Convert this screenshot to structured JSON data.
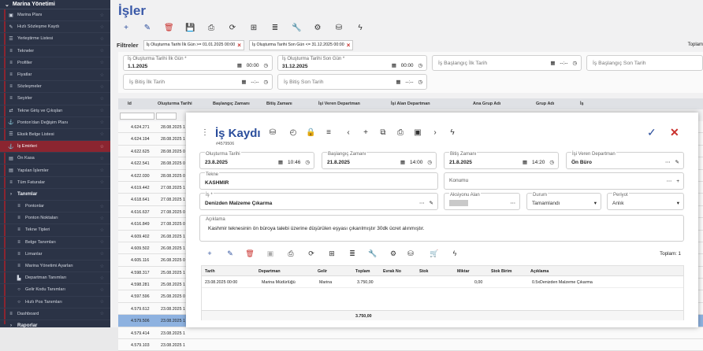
{
  "sidebar": {
    "title": "Marina Yönetimi",
    "items": [
      {
        "label": "Marina Planı",
        "icon": "▣",
        "type": "item"
      },
      {
        "label": "Hızlı Sözleşme Kaydı",
        "icon": "✎",
        "type": "item"
      },
      {
        "label": "Yerleştirme Listesi",
        "icon": "☰",
        "type": "item"
      },
      {
        "label": "Tekneler",
        "icon": "≡",
        "type": "item"
      },
      {
        "label": "Profiller",
        "icon": "≡",
        "type": "item"
      },
      {
        "label": "Fiyatlar",
        "icon": "≡",
        "type": "item"
      },
      {
        "label": "Sözleşmeler",
        "icon": "≡",
        "type": "item"
      },
      {
        "label": "Seyirler",
        "icon": "≡",
        "type": "item"
      },
      {
        "label": "Tekne Giriş ve Çıkışları",
        "icon": "⇄",
        "type": "item"
      },
      {
        "label": "Ponton'dan Değişim Planı",
        "icon": "⚓",
        "type": "item"
      },
      {
        "label": "Eksik Belge Listesi",
        "icon": "☰",
        "type": "item"
      },
      {
        "label": "İş Emirleri",
        "icon": "⚓",
        "type": "active"
      },
      {
        "label": "Ön Kasa",
        "icon": "▤",
        "type": "item"
      },
      {
        "label": "Yapılan İşlemler",
        "icon": "▤",
        "type": "item"
      },
      {
        "label": "Tüm Faturalar",
        "icon": "≡",
        "type": "item"
      },
      {
        "label": "Tanımlar",
        "icon": "›",
        "type": "group"
      },
      {
        "label": "Pontonlar",
        "icon": "≡",
        "type": "sub"
      },
      {
        "label": "Ponton Noktaları",
        "icon": "≡",
        "type": "sub"
      },
      {
        "label": "Tekne Tipleri",
        "icon": "≡",
        "type": "sub"
      },
      {
        "label": "Belge Tanımları",
        "icon": "≡",
        "type": "sub"
      },
      {
        "label": "Limanlar",
        "icon": "≡",
        "type": "sub"
      },
      {
        "label": "Marina Yönetimi Ayarları",
        "icon": "≡",
        "type": "sub"
      },
      {
        "label": "Departman Tanımları",
        "icon": "▙",
        "type": "sub"
      },
      {
        "label": "Gelir Kodu Tanımları",
        "icon": "○",
        "type": "sub"
      },
      {
        "label": "Hızlı Pos Tanımları",
        "icon": "○",
        "type": "sub"
      },
      {
        "label": "Dashboard",
        "icon": "≡",
        "type": "item"
      },
      {
        "label": "Raporlar",
        "icon": "›",
        "type": "group"
      }
    ]
  },
  "page": {
    "title": "İşler",
    "toolbar_icons": [
      "plus-icon",
      "edit-icon",
      "trash-icon",
      "save-icon",
      "print-icon",
      "refresh-icon",
      "excel-icon",
      "list-icon",
      "wrench-icon",
      "gear-icon",
      "database-icon",
      "bolt-icon"
    ],
    "toolbar_glyphs": [
      "+",
      "✎",
      "🗑",
      "💾",
      "⎙",
      "⟳",
      "⊞",
      "≣",
      "🔧",
      "⚙",
      "⛁",
      "ϟ"
    ]
  },
  "filters": {
    "label": "Filtreler",
    "chips": [
      "İş Oluşturma Tarihi İlk Gün >= 01.01.2025 00:00",
      "İş Oluşturma Tarihi Son Gün <= 31.12.2025 00:00"
    ],
    "toplam": "Toplam",
    "fields": {
      "created_first": {
        "label": "İş Oluşturma Tarihi İlk Gün *",
        "date": "1.1.2025",
        "time": "00:00"
      },
      "created_last": {
        "label": "İş Oluşturma Tarihi Son Gün *",
        "date": "31.12.2025",
        "time": "00:00"
      },
      "start_first": {
        "placeholder": "İş Başlangıç İlk Tarih",
        "time": "--:--"
      },
      "start_last": {
        "placeholder": "İş Başlangıç Son Tarih",
        "time": "--:--"
      },
      "end_first": {
        "placeholder": "İş Bitiş İlk Tarih",
        "time": "--:--"
      },
      "end_last": {
        "placeholder": "İş Bitiş Son Tarih",
        "time": "--:--"
      }
    }
  },
  "grid": {
    "columns": [
      "Id",
      "Oluşturma Tarihi",
      "Başlangıç Zamanı",
      "Bitiş Zamanı",
      "İşi Veren Departman",
      "İşi Alan Departman",
      "Ana Grup Adı",
      "Grup Adı",
      "İş"
    ],
    "rows": [
      {
        "id": "4.624.271",
        "date": "28.08.2025 1"
      },
      {
        "id": "4.624.194",
        "date": "28.08.2025 1"
      },
      {
        "id": "4.622.625",
        "date": "28.08.2025 0"
      },
      {
        "id": "4.622.541",
        "date": "28.08.2025 0"
      },
      {
        "id": "4.622.030",
        "date": "28.08.2025 0"
      },
      {
        "id": "4.619.442",
        "date": "27.08.2025 1"
      },
      {
        "id": "4.618.641",
        "date": "27.08.2025 1"
      },
      {
        "id": "4.616.637",
        "date": "27.08.2025 0"
      },
      {
        "id": "4.616.849",
        "date": "27.08.2025 0"
      },
      {
        "id": "4.609.402",
        "date": "26.08.2025 1"
      },
      {
        "id": "4.609.502",
        "date": "26.08.2025 1"
      },
      {
        "id": "4.605.116",
        "date": "26.08.2025 0"
      },
      {
        "id": "4.598.317",
        "date": "25.08.2025 1"
      },
      {
        "id": "4.598.281",
        "date": "25.08.2025 1"
      },
      {
        "id": "4.597.596",
        "date": "25.08.2025 0"
      },
      {
        "id": "4.579.612",
        "date": "23.08.2025 1"
      },
      {
        "id": "4.579.506",
        "date": "23.08.2025 1",
        "selected": true
      },
      {
        "id": "4.579.414",
        "date": "23.08.2025 1"
      },
      {
        "id": "4.579.103",
        "date": "23.08.2025 1"
      }
    ]
  },
  "modal": {
    "title": "İş Kaydı",
    "record_no": "#4579506",
    "fields": {
      "olusturma": {
        "label": "Oluşturma Tarihi",
        "date": "23.8.2025",
        "time": "10:46"
      },
      "baslangic": {
        "label": "Başlangıç Zamanı",
        "date": "21.8.2025",
        "time": "14:00"
      },
      "bitis": {
        "label": "Bitiş Zamanı",
        "date": "21.8.2025",
        "time": "14:20"
      },
      "veren": {
        "label": "İşi Veren Departman",
        "value": "Ön Büro"
      },
      "tekne": {
        "label": "Tekne",
        "value": "KASHMIR"
      },
      "konumu": {
        "placeholder": "Konumu"
      },
      "is": {
        "label": "İş *",
        "value": "Denizden Malzeme Çıkarma"
      },
      "aksiyonu": {
        "label": "Aksiyonu Alan"
      },
      "durum": {
        "label": "Durum",
        "value": "Tamamlandı"
      },
      "periyot": {
        "label": "Periyot",
        "value": "Anlık"
      },
      "aciklama": {
        "label": "Açıklama",
        "value": "Kashmir teknesinin ön büroya talebi üzerine düşürülen eşyası çıkarılmıştır 30dk ücret alınmıştır."
      }
    },
    "toplam": "Toplam: 1",
    "detail_columns": [
      "Tarih",
      "Departman",
      "Gelir",
      "Toplam",
      "Evrak No",
      "Stok",
      "Miktar",
      "Stok Birim",
      "Açıklama"
    ],
    "detail_rows": [
      {
        "tarih": "23.08.2025 00:00",
        "departman": "Marina Müdürlüğü",
        "gelir": "Marina",
        "toplam": "3.750,00",
        "evrak": "",
        "stok": "",
        "miktar": "0,00",
        "birim": "",
        "aciklama": "0.5xDenizden Malzeme Çıkarma"
      }
    ],
    "footer_total": "3.750,00"
  }
}
